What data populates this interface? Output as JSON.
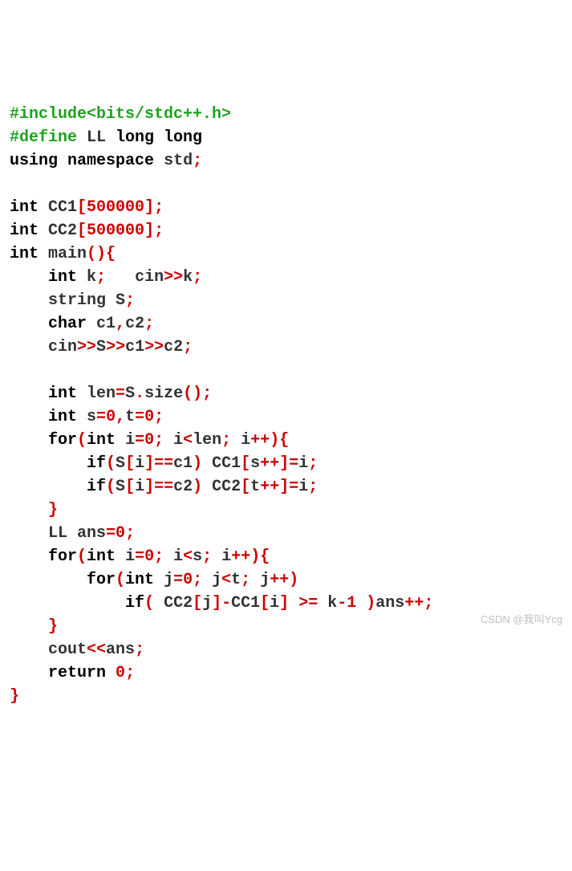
{
  "code": {
    "l1": {
      "pp": "#include",
      "rest": "<bits/stdc++.h>"
    },
    "l2": {
      "pp": "#define",
      "m1": " LL ",
      "kw": "long long"
    },
    "l3": {
      "kw1": "using",
      "sp1": " ",
      "kw2": "namespace",
      "sp2": " std",
      "p1": ";"
    },
    "l4": "",
    "l5": {
      "kw": "int",
      "name": " CC1",
      "b1": "[",
      "num": "500000",
      "b2": "];"
    },
    "l6": {
      "kw": "int",
      "name": " CC2",
      "b1": "[",
      "num": "500000",
      "b2": "];"
    },
    "l7": {
      "kw": "int",
      "name": " main",
      "p1": "(){"
    },
    "l8": {
      "kw": "int",
      "s1": " k",
      "p1": ";",
      "s2": "   cin",
      "p2": ">>",
      "s3": "k",
      "p3": ";"
    },
    "l9": {
      "s1": "string S",
      "p1": ";"
    },
    "l10": {
      "kw": "char",
      "s1": " c1",
      "p1": ",",
      "s2": "c2",
      "p2": ";"
    },
    "l11": {
      "s1": "cin",
      "p1": ">>",
      "s2": "S",
      "p2": ">>",
      "s3": "c1",
      "p3": ">>",
      "s4": "c2",
      "p4": ";"
    },
    "l12": "",
    "l13": {
      "kw": "int",
      "s1": " len",
      "p1": "=",
      "s2": "S",
      "p2": ".",
      "s3": "size",
      "p3": "();"
    },
    "l14": {
      "kw": "int",
      "s1": " s",
      "p1": "=",
      "n1": "0",
      "p2": ",",
      "s2": "t",
      "p3": "=",
      "n2": "0",
      "p4": ";"
    },
    "l15": {
      "kw1": "for",
      "p1": "(",
      "kw2": "int",
      "s1": " i",
      "p2": "=",
      "n1": "0",
      "p3": ";",
      "s2": " i",
      "p4": "<",
      "s3": "len",
      "p5": ";",
      "s4": " i",
      "p6": "++){"
    },
    "l16": {
      "kw": "if",
      "p1": "(",
      "s1": "S",
      "p2": "[",
      "s2": "i",
      "p3": "]==",
      "s3": "c1",
      "p4": ")",
      "s4": " CC1",
      "p5": "[",
      "s5": "s",
      "p6": "++]=",
      "s6": "i",
      "p7": ";"
    },
    "l17": {
      "kw": "if",
      "p1": "(",
      "s1": "S",
      "p2": "[",
      "s2": "i",
      "p3": "]==",
      "s3": "c2",
      "p4": ")",
      "s4": " CC2",
      "p5": "[",
      "s5": "t",
      "p6": "++]=",
      "s6": "i",
      "p7": ";"
    },
    "l18": {
      "p1": "}"
    },
    "l19": {
      "s1": "LL ans",
      "p1": "=",
      "n1": "0",
      "p2": ";"
    },
    "l20": {
      "kw1": "for",
      "p1": "(",
      "kw2": "int",
      "s1": " i",
      "p2": "=",
      "n1": "0",
      "p3": ";",
      "s2": " i",
      "p4": "<",
      "s3": "s",
      "p5": ";",
      "s4": " i",
      "p6": "++){"
    },
    "l21": {
      "kw1": "for",
      "p1": "(",
      "kw2": "int",
      "s1": " j",
      "p2": "=",
      "n1": "0",
      "p3": ";",
      "s2": " j",
      "p4": "<",
      "s3": "t",
      "p5": ";",
      "s4": " j",
      "p6": "++)"
    },
    "l22": {
      "kw": "if",
      "p1": "(",
      "s1": " CC2",
      "p2": "[",
      "s2": "j",
      "p3": "]-",
      "s3": "CC1",
      "p4": "[",
      "s4": "i",
      "p5": "]",
      "s5": " ",
      "p6": ">=",
      "s6": " k",
      "p7": "-",
      "n1": "1",
      "s7": " ",
      "p8": ")",
      "s8": "ans",
      "p9": "++;"
    },
    "l23": {
      "p1": "}"
    },
    "l24": {
      "s1": "cout",
      "p1": "<<",
      "s2": "ans",
      "p2": ";"
    },
    "l25": {
      "kw": "return",
      "s1": " ",
      "n1": "0",
      "p1": ";"
    },
    "l26": {
      "p1": "}"
    }
  },
  "indent": {
    "i1": "    ",
    "i2": "        ",
    "i3": "            "
  },
  "watermark": "CSDN @我叫Ycg"
}
